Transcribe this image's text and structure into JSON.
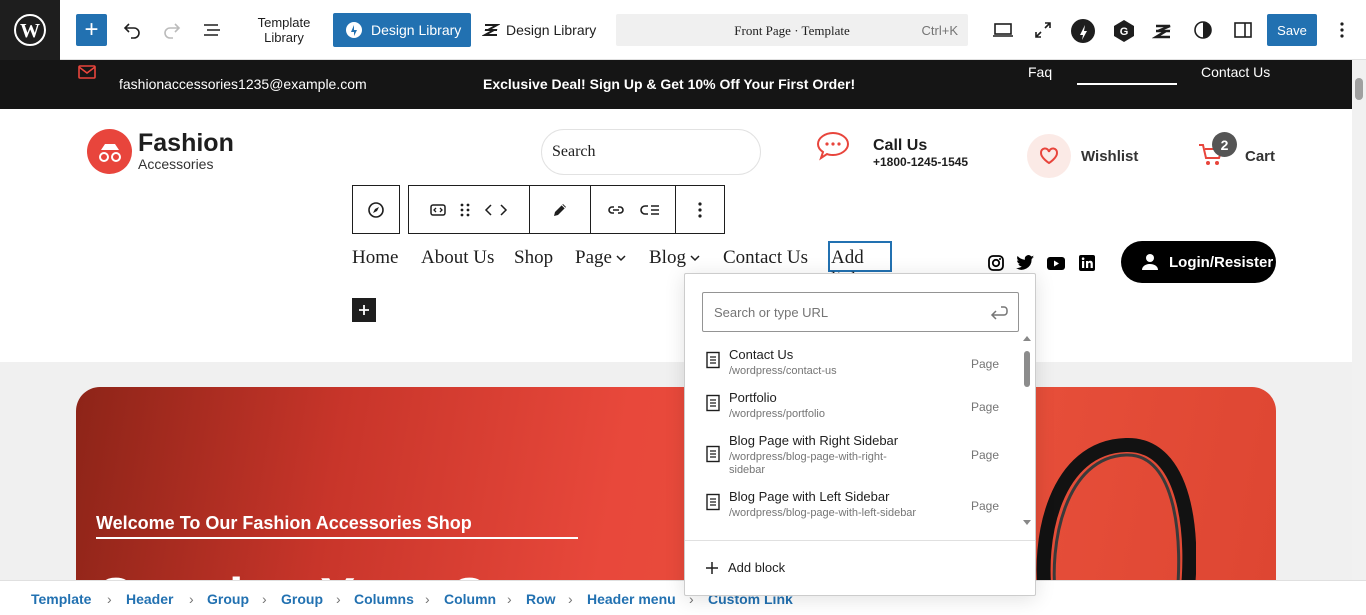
{
  "toolbar": {
    "template_library": "Template Library",
    "design_library_button": "Design Library",
    "design_library_link": "Design Library",
    "command_title": "Front Page · Template",
    "command_shortcut": "Ctrl+K",
    "save": "Save",
    "accent": "#2271b1"
  },
  "topbar": {
    "email": "fashionaccessories1235@example.com",
    "deal": "Exclusive Deal! Sign Up & Get 10% Off Your First Order!",
    "faq": "Faq",
    "contact": "Contact Us"
  },
  "header": {
    "logo_title": "Fashion",
    "logo_subtitle": "Accessories",
    "search_label": "Search",
    "call_title": "Call Us",
    "call_number": "+1800-1245-1545",
    "wishlist": "Wishlist",
    "cart_count": "2",
    "cart": "Cart",
    "brand_color": "#e8453c"
  },
  "nav": {
    "items": [
      "Home",
      "About Us",
      "Shop",
      "Page",
      "Blog",
      "Contact Us"
    ],
    "add_link": "Add link",
    "login": "Login/Resister"
  },
  "hero": {
    "welcome": "Welcome To Our Fashion Accessories Shop",
    "headline": "Creating Your C"
  },
  "link_popover": {
    "placeholder": "Search or type URL",
    "suggestions": [
      {
        "title": "Contact Us",
        "url": "/wordpress/contact-us",
        "type": "Page"
      },
      {
        "title": "Portfolio",
        "url": "/wordpress/portfolio",
        "type": "Page"
      },
      {
        "title": "Blog Page with Right Sidebar",
        "url": "/wordpress/blog-page-with-right-sidebar",
        "type": "Page"
      },
      {
        "title": "Blog Page with Left Sidebar",
        "url": "/wordpress/blog-page-with-left-sidebar",
        "type": "Page"
      }
    ],
    "add_block": "Add block"
  },
  "breadcrumb": [
    "Template",
    "Header",
    "Group",
    "Group",
    "Columns",
    "Column",
    "Row",
    "Header menu",
    "Custom Link"
  ]
}
